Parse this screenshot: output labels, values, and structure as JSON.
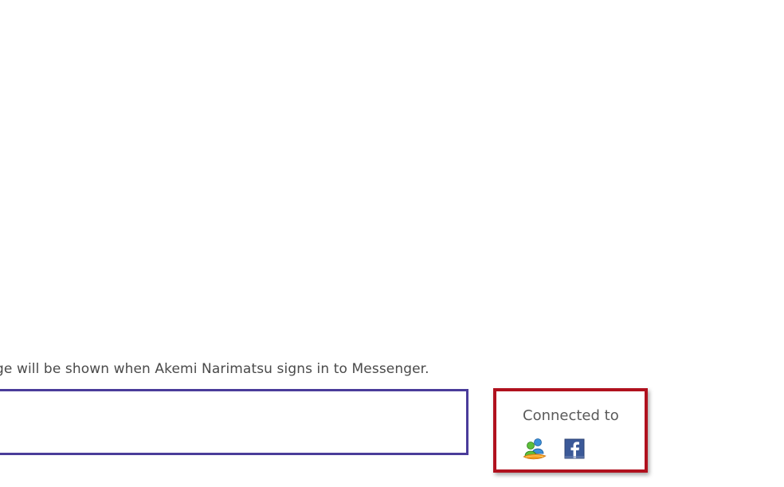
{
  "status": {
    "offline_note": "ge will be shown when Akemi Narimatsu signs in to Messenger."
  },
  "message_box": {
    "value": "",
    "placeholder": ""
  },
  "connected": {
    "label": "Connected to",
    "services": [
      {
        "name": "Windows Live Messenger",
        "icon": "messenger-buddies-icon"
      },
      {
        "name": "Facebook",
        "icon": "facebook-icon"
      }
    ]
  },
  "colors": {
    "input_border": "#4a3c9a",
    "highlight_border": "#b0111e",
    "facebook_blue": "#3b5998"
  }
}
